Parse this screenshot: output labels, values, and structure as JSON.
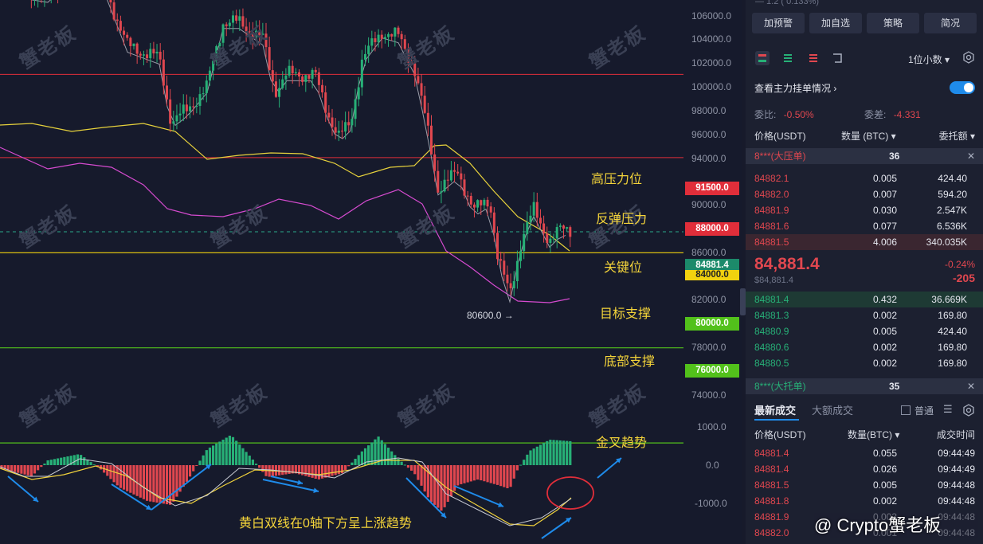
{
  "watermark": "蟹老板",
  "axis_ticks": [
    "106000.0",
    "104000.0",
    "102000.0",
    "100000.0",
    "98000.0",
    "96000.0",
    "94000.0",
    "90000.0",
    "86000.0",
    "82000.0",
    "78000.0",
    "74000.0",
    "1000.0",
    "0.0",
    "-1000.0"
  ],
  "levels": {
    "high_pressure": {
      "price": "91500.0",
      "label": "高压力位",
      "color": "#e02e3a"
    },
    "rebound_pressure": {
      "price": "88000.0",
      "label": "反弹压力",
      "color": "#e02e3a"
    },
    "key_level": {
      "price": "84000.0",
      "label": "关键位",
      "color": "#f1d20f"
    },
    "current": {
      "price": "84881.4",
      "color": "#1c8a6a"
    },
    "target_support": {
      "price": "80000.0",
      "label": "目标支撑",
      "color": "#52c11b"
    },
    "bottom_support": {
      "price": "76000.0",
      "label": "底部支撑",
      "color": "#52c11b"
    }
  },
  "low_marker": "80600.0 →",
  "macd_labels": {
    "golden_cross": "金叉趋势",
    "trend_note": "黄白双线在0轴下方呈上涨趋势"
  },
  "colors": {
    "up": "#27b077",
    "down": "#e0474f",
    "upper_band": "#e7d23c",
    "lower_band": "#d64bd0",
    "mid_band": "#9a9ca8"
  },
  "side": {
    "top_partial": "— 1.2 ( 0.133%)",
    "buttons": [
      "加预警",
      "加自选",
      "策略",
      "简况"
    ],
    "decimal_select": "1位小数 ▾",
    "view_main_orders": "查看主力挂单情况",
    "ratio_label": "委比:",
    "ratio_value": "-0.50%",
    "diff_label": "委差:",
    "diff_value": "-4.331",
    "book_headers": {
      "price": "价格(USDT)",
      "qty": "数量 (BTC) ▾",
      "amount": "委托额 ▾"
    },
    "big_sell": {
      "name": "8***(大压单)",
      "qty": "36"
    },
    "asks": [
      {
        "price": "84882.1",
        "qty": "0.005",
        "amt": "424.40"
      },
      {
        "price": "84882.0",
        "qty": "0.007",
        "amt": "594.20"
      },
      {
        "price": "84881.9",
        "qty": "0.030",
        "amt": "2.547K"
      },
      {
        "price": "84881.6",
        "qty": "0.077",
        "amt": "6.536K"
      },
      {
        "price": "84881.5",
        "qty": "4.006",
        "amt": "340.035K"
      }
    ],
    "last_price": "84,881.4",
    "last_price_sub": "$84,881.4",
    "change_pct": "-0.24%",
    "change_abs": "-205",
    "bids": [
      {
        "price": "84881.4",
        "qty": "0.432",
        "amt": "36.669K"
      },
      {
        "price": "84881.3",
        "qty": "0.002",
        "amt": "169.80"
      },
      {
        "price": "84880.9",
        "qty": "0.005",
        "amt": "424.40"
      },
      {
        "price": "84880.6",
        "qty": "0.002",
        "amt": "169.80"
      },
      {
        "price": "84880.5",
        "qty": "0.002",
        "amt": "169.80"
      }
    ],
    "big_buy": {
      "name": "8***(大托单)",
      "qty": "35"
    },
    "trade_tabs": [
      "最新成交",
      "大额成交"
    ],
    "normal_label": "普通",
    "trade_headers": {
      "price": "价格(USDT)",
      "qty": "数量(BTC) ▾",
      "time": "成交时间"
    },
    "trades": [
      {
        "price": "84881.4",
        "qty": "0.055",
        "time": "09:44:49"
      },
      {
        "price": "84881.4",
        "qty": "0.026",
        "time": "09:44:49"
      },
      {
        "price": "84881.5",
        "qty": "0.005",
        "time": "09:44:48"
      },
      {
        "price": "84881.8",
        "qty": "0.002",
        "time": "09:44:48"
      },
      {
        "price": "84881.9",
        "qty": "0.003",
        "time": "09:44:48"
      },
      {
        "price": "84882.0",
        "qty": "0.001",
        "time": "09:44:48"
      }
    ],
    "brand": "@ Crypto蟹老板"
  }
}
